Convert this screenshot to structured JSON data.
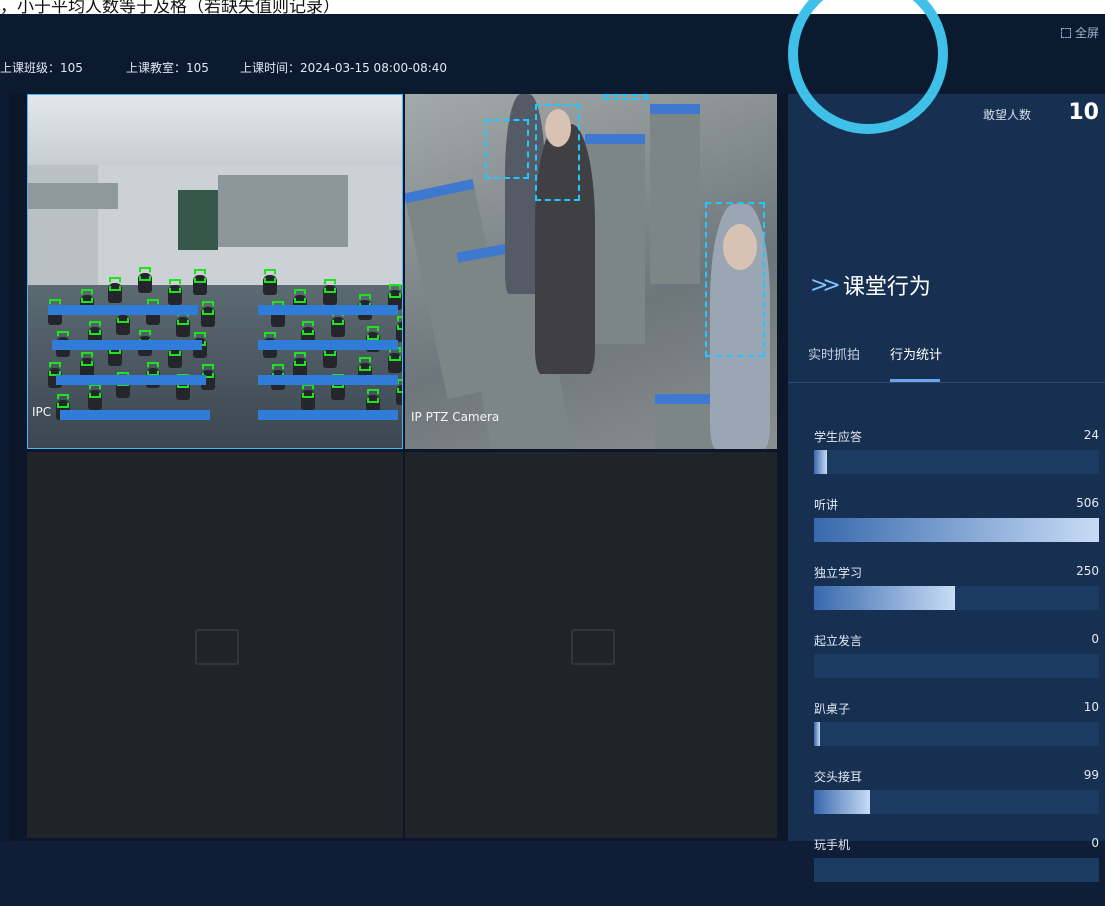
{
  "top_cut_text": "，小于平均人数等于及格（若缺失值则记录）",
  "header": {
    "fullscreen_label": "全屏",
    "class_info": "上课班级：105",
    "room_info": "上课教室：105",
    "time_info": "上课时间：2024-03-15 08:00-08:40"
  },
  "videos": {
    "cam1_label": "IPC",
    "cam2_label": "IP PTZ Camera"
  },
  "panel": {
    "count_label": "敢望人数",
    "count_value": "10",
    "section_title": "课堂行为",
    "tabs": [
      "实时抓拍",
      "行为统计"
    ],
    "active_tab": 1,
    "stats": [
      {
        "label": "学生应答",
        "value": 24,
        "fraction": 0.047
      },
      {
        "label": "听讲",
        "value": 506,
        "fraction": 1.0
      },
      {
        "label": "独立学习",
        "value": 250,
        "fraction": 0.494
      },
      {
        "label": "起立发言",
        "value": 0,
        "fraction": 0.0
      },
      {
        "label": "趴桌子",
        "value": 10,
        "fraction": 0.02
      },
      {
        "label": "交头接耳",
        "value": 99,
        "fraction": 0.196
      },
      {
        "label": "玩手机",
        "value": 0,
        "fraction": 0.0
      }
    ]
  },
  "colors": {
    "accent": "#41b8ff",
    "ring": "#3fc0e8",
    "bar_start": "#3869ad",
    "bar_end": "#c8dcf6",
    "detection_green": "#1fe31f"
  }
}
